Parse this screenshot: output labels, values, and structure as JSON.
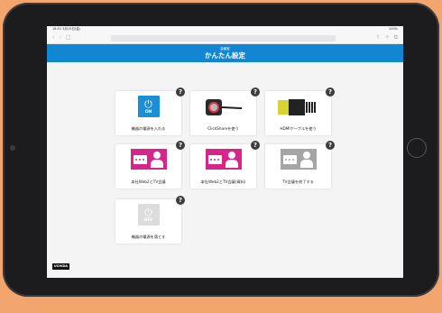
{
  "status": {
    "left": "18:51 3月15日(金)",
    "right": "100%"
  },
  "header": {
    "subtitle": "会議室",
    "title": "かんたん設定"
  },
  "cards": [
    {
      "label": "機器の電源を入れる",
      "icon": "power-on-icon",
      "text": "ON"
    },
    {
      "label": "ClickShareを使う",
      "icon": "clickshare-icon"
    },
    {
      "label": "HDMIケーブルを使う",
      "icon": "hdmi-icon"
    },
    {
      "label": "本社Web2とTV会議",
      "icon": "meeting-icon"
    },
    {
      "label": "本社Web2とTV会議(資料)",
      "icon": "meeting-icon"
    },
    {
      "label": "TV会議を終了する",
      "icon": "meeting-end-icon"
    },
    {
      "label": "機器の電源を落とす",
      "icon": "power-off-icon",
      "text": "OFF"
    }
  ],
  "help_symbol": "?",
  "logo": "UCHIDA",
  "colors": {
    "header": "#1187d4",
    "meeting": "#d8258c",
    "power": "#1a8fd6"
  }
}
